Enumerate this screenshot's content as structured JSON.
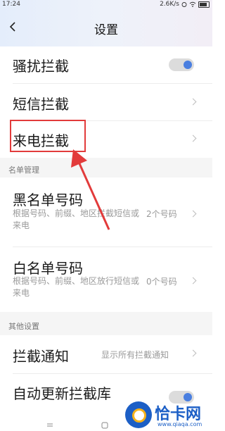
{
  "status_bar": {
    "time": "17:24",
    "speed": "2.6K/s"
  },
  "header": {
    "title": "设置"
  },
  "rows": {
    "harassment": {
      "label": "骚扰拦截",
      "toggle_on": true
    },
    "sms": {
      "label": "短信拦截"
    },
    "call": {
      "label": "来电拦截"
    }
  },
  "section_list": {
    "title": "名单管理",
    "blacklist": {
      "label": "黑名单号码",
      "desc": "根据号码、前缀、地区拦截短信或来电",
      "value": "2个号码"
    },
    "whitelist": {
      "label": "白名单号码",
      "desc": "根据号码、前缀、地区放行短信或来电",
      "value": "0个号码"
    }
  },
  "section_other": {
    "title": "其他设置",
    "notify": {
      "label": "拦截通知",
      "value": "显示所有拦截通知"
    },
    "autoupdate": {
      "label": "自动更新拦截库"
    }
  },
  "watermark": {
    "text": "恰卡网",
    "url": "www.qiaqa.com"
  },
  "colors": {
    "accent": "#4a7fe0",
    "highlight": "#e23b3b"
  }
}
